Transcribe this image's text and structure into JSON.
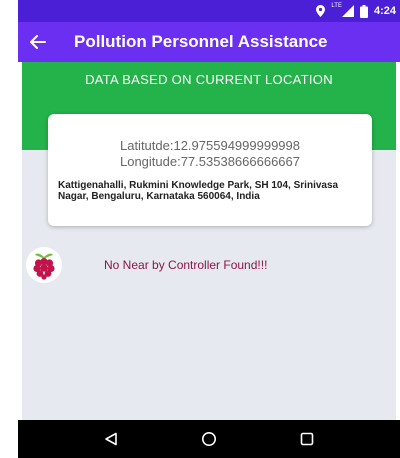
{
  "status_bar": {
    "time": "4:24",
    "network_label": "LTE"
  },
  "app_bar": {
    "title": "Pollution Personnel Assistance"
  },
  "location": {
    "header": "DATA BASED ON CURRENT LOCATION",
    "latitude_text": "Latitutde:12.975594999999998",
    "longitude_text": "Longitude:77.53538666666667",
    "address": "Kattigenahalli, Rukmini Knowledge Park, SH 104, Srinivasa Nagar, Bengaluru, Karnataka 560064, India"
  },
  "controller": {
    "message": "No Near by Controller Found!!!"
  },
  "icons": {
    "back": "arrow-left-icon",
    "controller": "raspberry-pi-icon",
    "nav_back": "triangle-back-icon",
    "nav_home": "circle-home-icon",
    "nav_recent": "square-recent-icon"
  },
  "colors": {
    "status_bar": "#4a1fd6",
    "app_bar": "#6a2ff0",
    "band": "#24b24a",
    "message": "#8b1747"
  }
}
